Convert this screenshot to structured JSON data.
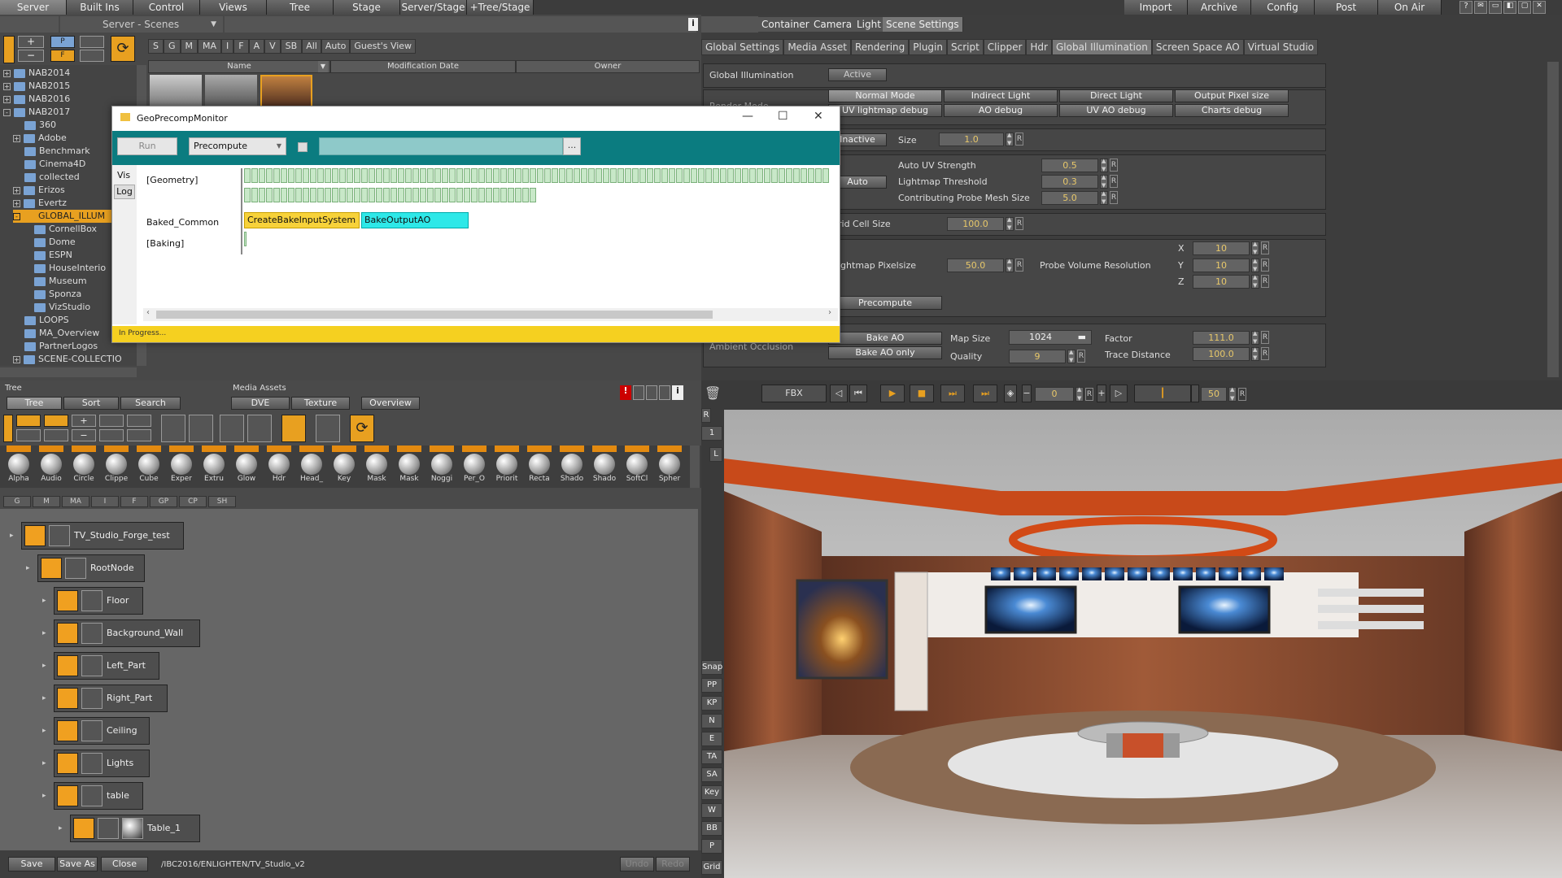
{
  "menubar": {
    "items": [
      "Server",
      "Built Ins",
      "Control",
      "Views",
      "Tree",
      "Stage",
      "Server/Stage",
      "+Tree/Stage"
    ],
    "right_items": [
      "Import",
      "Archive",
      "Config",
      "Post",
      "On Air"
    ]
  },
  "server_panel": {
    "title": "Server - Scenes",
    "filter_tabs": [
      "S",
      "G",
      "M",
      "MA",
      "I",
      "F",
      "A",
      "V",
      "SB",
      "All",
      "Auto",
      "Guest's View"
    ],
    "columns": [
      "Name",
      "Modification Date",
      "Owner"
    ],
    "tree": [
      {
        "label": "NAB2014",
        "expand": "+"
      },
      {
        "label": "NAB2015",
        "expand": "+"
      },
      {
        "label": "NAB2016",
        "expand": "+"
      },
      {
        "label": "NAB2017",
        "expand": "-"
      },
      {
        "label": "360",
        "expand": ""
      },
      {
        "label": "Adobe",
        "expand": "+"
      },
      {
        "label": "Benchmark",
        "expand": ""
      },
      {
        "label": "Cinema4D",
        "expand": ""
      },
      {
        "label": "collected",
        "expand": ""
      },
      {
        "label": "Erizos",
        "expand": "+"
      },
      {
        "label": "Evertz",
        "expand": "+"
      },
      {
        "label": "GLOBAL_ILLUM",
        "expand": "-"
      },
      {
        "label": "CornellBox",
        "expand": ""
      },
      {
        "label": "Dome",
        "expand": ""
      },
      {
        "label": "ESPN",
        "expand": ""
      },
      {
        "label": "HouseInterio",
        "expand": ""
      },
      {
        "label": "Museum",
        "expand": ""
      },
      {
        "label": "Sponza",
        "expand": ""
      },
      {
        "label": "VizStudio",
        "expand": ""
      },
      {
        "label": "LOOPS",
        "expand": ""
      },
      {
        "label": "MA_Overview",
        "expand": ""
      },
      {
        "label": "PartnerLogos",
        "expand": ""
      },
      {
        "label": "SCENE-COLLECTIO",
        "expand": "+"
      }
    ]
  },
  "dialog": {
    "title": "GeoPrecompMonitor",
    "run_label": "Run",
    "mode_value": "Precompute",
    "browse_label": "...",
    "side_tabs": [
      "Vis",
      "Log"
    ],
    "rows": [
      "[Geometry]",
      "Baked_Common",
      "[Baking]"
    ],
    "task1": "CreateBakeInputSystem",
    "task2": "BakeOutputAO",
    "status": "In Progress..."
  },
  "scene_tabs": [
    "Container",
    "Camera",
    "Light",
    "Scene Settings"
  ],
  "settings_tabs": [
    "Global Settings",
    "Media Asset",
    "Rendering",
    "Plugin",
    "Script",
    "Clipper",
    "Hdr",
    "Global Illumination",
    "Screen Space AO",
    "Virtual Studio"
  ],
  "gi": {
    "title": "Global Illumination",
    "active_label": "Active",
    "render_mode_label": "Render Mode",
    "mode_buttons": [
      "Normal Mode",
      "Indirect Light",
      "Direct Light",
      "Output Pixel size",
      "UV lightmap debug",
      "AO debug",
      "UV AO debug",
      "Charts debug"
    ],
    "inactive_label": "Inactive",
    "size_label": "Size",
    "size_value": "1.0",
    "auto_label": "Auto",
    "auto_uv_label": "Auto UV Strength",
    "auto_uv_value": "0.5",
    "lightmap_thr_label": "Lightmap Threshold",
    "lightmap_thr_value": "0.3",
    "probe_mesh_label": "Contributing Probe Mesh Size",
    "probe_mesh_value": "5.0",
    "grid_label": "rid Cell Size",
    "grid_value": "100.0",
    "lm_pix_label": "ightmap Pixelsize",
    "lm_pix_value": "50.0",
    "probe_res_label": "Probe Volume Resolution",
    "x_label": "X",
    "x_value": "10",
    "y_label": "Y",
    "y_value": "10",
    "z_label": "Z",
    "z_value": "10",
    "precompute_label": "Precompute",
    "ao_label": "Ambient Occlusion",
    "bake_ao_label": "Bake AO",
    "bake_ao_only_label": "Bake AO only",
    "map_size_label": "Map Size",
    "map_size_value": "1024",
    "quality_label": "Quality",
    "quality_value": "9",
    "factor_label": "Factor",
    "factor_value": "111.0",
    "trace_label": "Trace Distance",
    "trace_value": "100.0",
    "r_label": "R"
  },
  "tree_panel": {
    "section_tree": "Tree",
    "section_media": "Media Assets",
    "tabs": [
      "Tree",
      "Sort",
      "Search"
    ],
    "media_tabs": [
      "DVE",
      "Texture",
      "Overview"
    ],
    "palette": [
      "Alpha",
      "Audio",
      "Circle",
      "Clippe",
      "Cube",
      "Exper",
      "Extru",
      "Glow",
      "Hdr",
      "Head_",
      "Key",
      "Mask",
      "Mask",
      "Noggi",
      "Per_O",
      "Priorit",
      "Recta",
      "Shado",
      "Shado",
      "SoftCl",
      "Spher"
    ],
    "filter": [
      "G",
      "M",
      "MA",
      "I",
      "F",
      "GP",
      "CP",
      "SH"
    ],
    "nodes": [
      "TV_Studio_Forge_test",
      "RootNode",
      "Floor",
      "Background_Wall",
      "Left_Part",
      "Right_Part",
      "Ceiling",
      "Lights",
      "table",
      "Table_1"
    ]
  },
  "bottom": {
    "save": "Save",
    "save_as": "Save As",
    "close": "Close",
    "path": "/IBC2016/ENLIGHTEN/TV_Studio_v2",
    "undo": "Undo",
    "redo": "Redo",
    "grid": "Grid"
  },
  "side_strip": [
    "Snap",
    "PP",
    "KP",
    "N",
    "E",
    "TA",
    "SA",
    "Key",
    "W",
    "BB",
    "P"
  ],
  "viewport": {
    "fbx_label": "FBX",
    "frame_value": "0",
    "r_label": "R",
    "fps_value": "50"
  }
}
